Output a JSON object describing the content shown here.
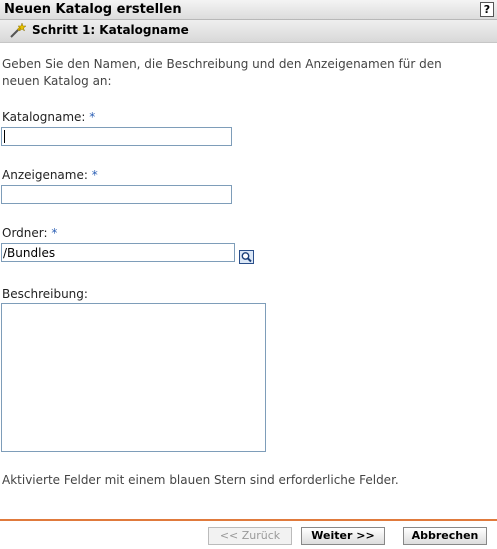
{
  "window": {
    "title": "Neuen Katalog erstellen",
    "help_label": "?"
  },
  "step": {
    "title": "Schritt 1: Katalogname",
    "icon": "wizard-wand-icon"
  },
  "intro_text": "Geben Sie den Namen, die Beschreibung und den Anzeigenamen für den neuen Katalog an:",
  "form": {
    "catalog_name": {
      "label": "Katalogname:",
      "required": "*",
      "value": ""
    },
    "display_name": {
      "label": "Anzeigename:",
      "required": "*",
      "value": ""
    },
    "folder": {
      "label": "Ordner:",
      "required": "*",
      "value": "/Bundles",
      "browse_icon": "magnifier-browse-icon"
    },
    "description": {
      "label": "Beschreibung:",
      "value": ""
    }
  },
  "note": "Aktivierte Felder mit einem blauen Stern sind erforderliche Felder.",
  "buttons": {
    "back": "<< Zurück",
    "next": "Weiter >>",
    "cancel": "Abbrechen"
  },
  "colors": {
    "required_star": "#2b5fb5",
    "divider": "#e07a3c",
    "field_border": "#7e9db9"
  }
}
